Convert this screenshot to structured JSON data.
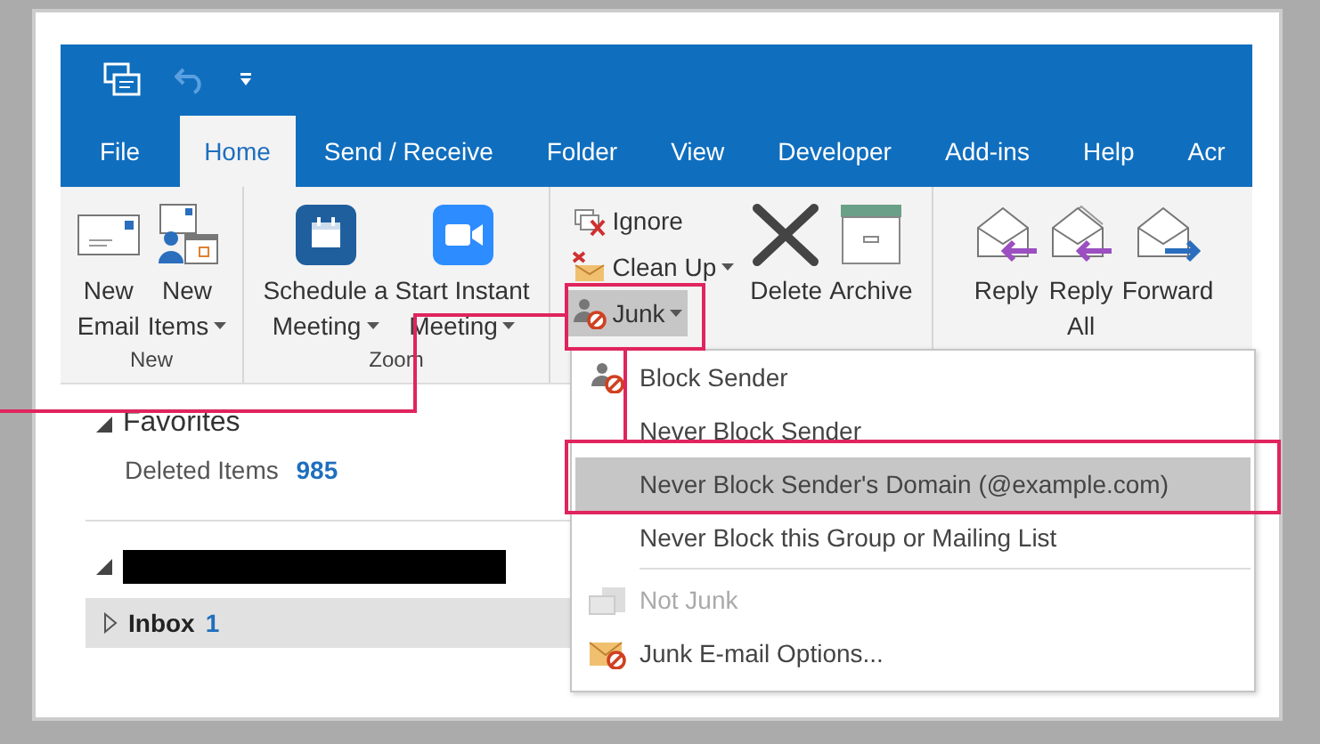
{
  "tabs": [
    {
      "label": "File",
      "selected": false
    },
    {
      "label": "Home",
      "selected": true
    },
    {
      "label": "Send / Receive",
      "selected": false
    },
    {
      "label": "Folder",
      "selected": false
    },
    {
      "label": "View",
      "selected": false
    },
    {
      "label": "Developer",
      "selected": false
    },
    {
      "label": "Add-ins",
      "selected": false
    },
    {
      "label": "Help",
      "selected": false
    },
    {
      "label": "Acr",
      "selected": false
    }
  ],
  "ribbon": {
    "groups": [
      {
        "label": "New",
        "buttons": [
          {
            "kind": "new-email",
            "lines": [
              "New",
              "Email"
            ],
            "dropdown": false
          },
          {
            "kind": "new-items",
            "lines": [
              "New",
              "Items"
            ],
            "dropdown": true
          }
        ]
      },
      {
        "label": "Zoom",
        "buttons": [
          {
            "kind": "schedule",
            "lines": [
              "Schedule a",
              "Meeting"
            ],
            "dropdown": true
          },
          {
            "kind": "instant",
            "lines": [
              "Start Instant",
              "Meeting"
            ],
            "dropdown": true
          }
        ]
      },
      {
        "small": [
          {
            "kind": "ignore",
            "label": "Ignore",
            "dropdown": false,
            "selected": false
          },
          {
            "kind": "cleanup",
            "label": "Clean Up",
            "dropdown": true,
            "selected": false
          },
          {
            "kind": "junk",
            "label": "Junk",
            "dropdown": true,
            "selected": true
          }
        ],
        "buttons": [
          {
            "kind": "delete",
            "lines": [
              "Delete"
            ],
            "dropdown": false
          },
          {
            "kind": "archive",
            "lines": [
              "Archive"
            ],
            "dropdown": false
          }
        ]
      },
      {
        "buttons": [
          {
            "kind": "reply",
            "lines": [
              "Reply"
            ],
            "dropdown": false
          },
          {
            "kind": "reply-all",
            "lines": [
              "Reply",
              "All"
            ],
            "dropdown": false
          },
          {
            "kind": "forward",
            "lines": [
              "Forward"
            ],
            "dropdown": false
          }
        ]
      }
    ]
  },
  "nav": {
    "favorites": {
      "title": "Favorites",
      "items": [
        {
          "name": "Deleted Items",
          "count": "985"
        }
      ]
    },
    "folders": [
      {
        "name": "Inbox",
        "count": "1",
        "selected": true
      }
    ]
  },
  "junk_menu": [
    {
      "kind": "block",
      "label": "Block Sender",
      "selected": false,
      "disabled": false
    },
    {
      "kind": "plain",
      "label": "Never Block Sender",
      "selected": false,
      "disabled": false
    },
    {
      "kind": "plain",
      "label": "Never Block Sender's Domain (@example.com)",
      "selected": true,
      "disabled": false
    },
    {
      "kind": "plain",
      "label": "Never Block this Group or Mailing List",
      "selected": false,
      "disabled": false
    },
    {
      "kind": "separator"
    },
    {
      "kind": "notjunk",
      "label": "Not Junk",
      "selected": false,
      "disabled": true
    },
    {
      "kind": "options",
      "label": "Junk E-mail Options...",
      "selected": false,
      "disabled": false
    }
  ]
}
